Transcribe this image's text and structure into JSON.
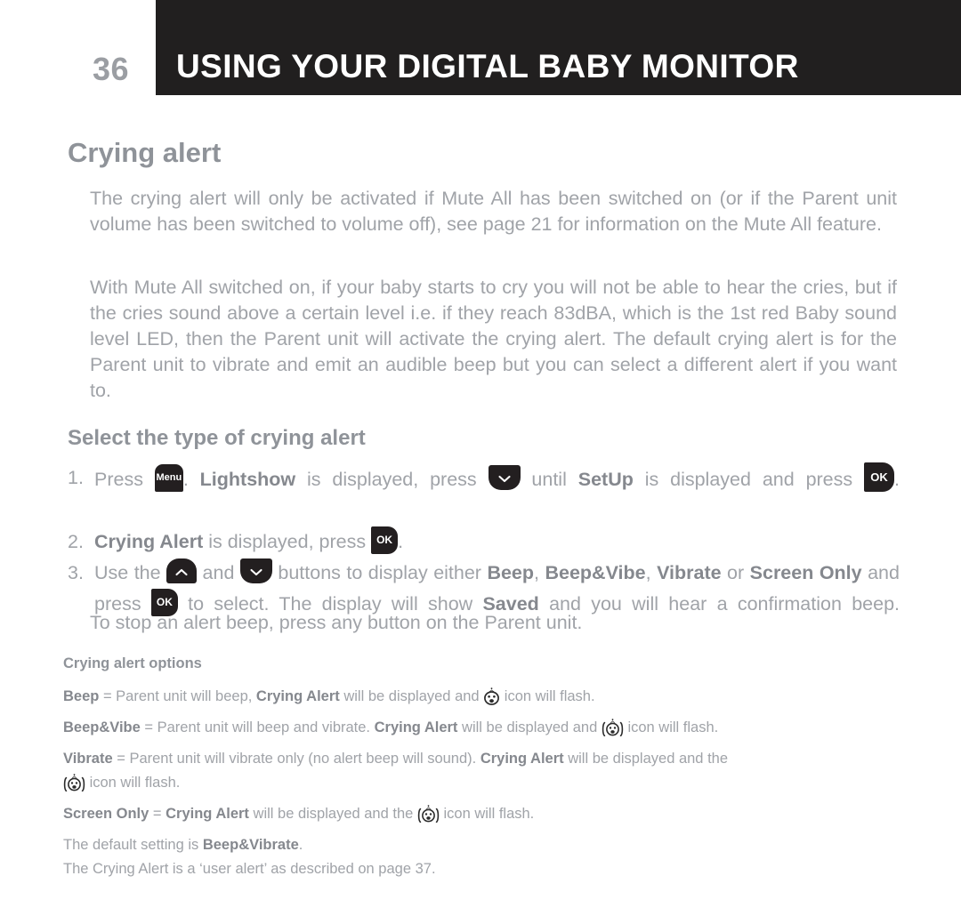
{
  "header": {
    "page_number": "36",
    "title": "USING YOUR DIGITAL BABY MONITOR",
    "bar_color": "#211f1f",
    "title_color": "#ffffff",
    "page_number_color": "#9b9ea3"
  },
  "section": {
    "title": "Crying alert",
    "paragraph_1": "The crying alert will only be activated if Mute All has been switched on (or if the Parent unit volume has been switched to volume off), see page 21 for information on the Mute All feature.",
    "paragraph_2": "With Mute All switched on, if your baby starts to cry you will not be able to hear the cries, but if the cries sound above a certain level i.e. if they reach 83dBA, which is the 1st red Baby sound level LED, then the Parent unit will activate the crying alert. The default crying alert is for the Parent unit to vibrate and emit an audible beep but you can select a different alert if you want to."
  },
  "subsection": {
    "title": "Select the type of crying alert",
    "steps": [
      {
        "number": "1.",
        "t1": "Press ",
        "key1": "Menu",
        "t2": ". ",
        "b1": "Lightshow",
        "t3": " is displayed, press ",
        "key2": "chevron-down",
        "t4": " until ",
        "b2": "SetUp",
        "t5": " is displayed and press ",
        "key3": "OK",
        "t6": "."
      },
      {
        "number": "2.",
        "b1": "Crying Alert",
        "t1": " is displayed, press ",
        "key1": "OK",
        "t2": "."
      },
      {
        "number": "3.",
        "t1": "Use the ",
        "key1": "chevron-up",
        "t2": " and ",
        "key2": "chevron-down",
        "t3": " buttons to display either ",
        "b1": "Beep",
        "t4": ", ",
        "b2": "Beep&Vibe",
        "t5": ", ",
        "b3": "Vibrate",
        "t6": " or ",
        "b4": "Screen Only",
        "t7": " and press ",
        "key3": "OK",
        "t8": " to select. The display will show ",
        "b5": "Saved",
        "t9": " and you will hear a confirmation beep."
      }
    ],
    "note": "To stop an alert beep, press any button on the Parent unit."
  },
  "options": {
    "heading": "Crying alert options",
    "lines": [
      {
        "bold_lead": "Beep",
        "text_a": " = Parent unit will beep, ",
        "bold_mid": "Crying Alert",
        "text_b": " will be displayed and ",
        "icon": "baby-face-icon",
        "text_c": " icon will flash."
      },
      {
        "bold_lead": "Beep&Vibe",
        "text_a": " = Parent unit will beep and vibrate. ",
        "bold_mid": "Crying Alert",
        "text_b": " will be displayed and ",
        "icon": "baby-face-vibrate-icon",
        "text_c": " icon will flash."
      },
      {
        "bold_lead": "Vibrate",
        "text_a": " = Parent unit will vibrate only (no alert beep will sound). ",
        "bold_mid": "Crying Alert",
        "text_b": " will be displayed and the ",
        "icon": "baby-face-vibrate-icon",
        "text_c": " icon will flash."
      },
      {
        "bold_lead": "Screen Only",
        "text_a": " = ",
        "bold_mid": "Crying Alert",
        "text_b": " will be displayed and the ",
        "icon": "baby-face-vibrate-icon",
        "text_c": " icon will flash."
      }
    ],
    "default_text_a": "The default setting is ",
    "default_bold": "Beep&Vibrate",
    "default_text_b": ".",
    "footer": "The Crying Alert is a ‘user alert’ as described on page 37."
  },
  "colors": {
    "body_text": "#a0a3a8",
    "bold_text": "#85888e",
    "heading": "#8f9399",
    "key_background": "#231f20",
    "page_background": "#ffffff"
  }
}
